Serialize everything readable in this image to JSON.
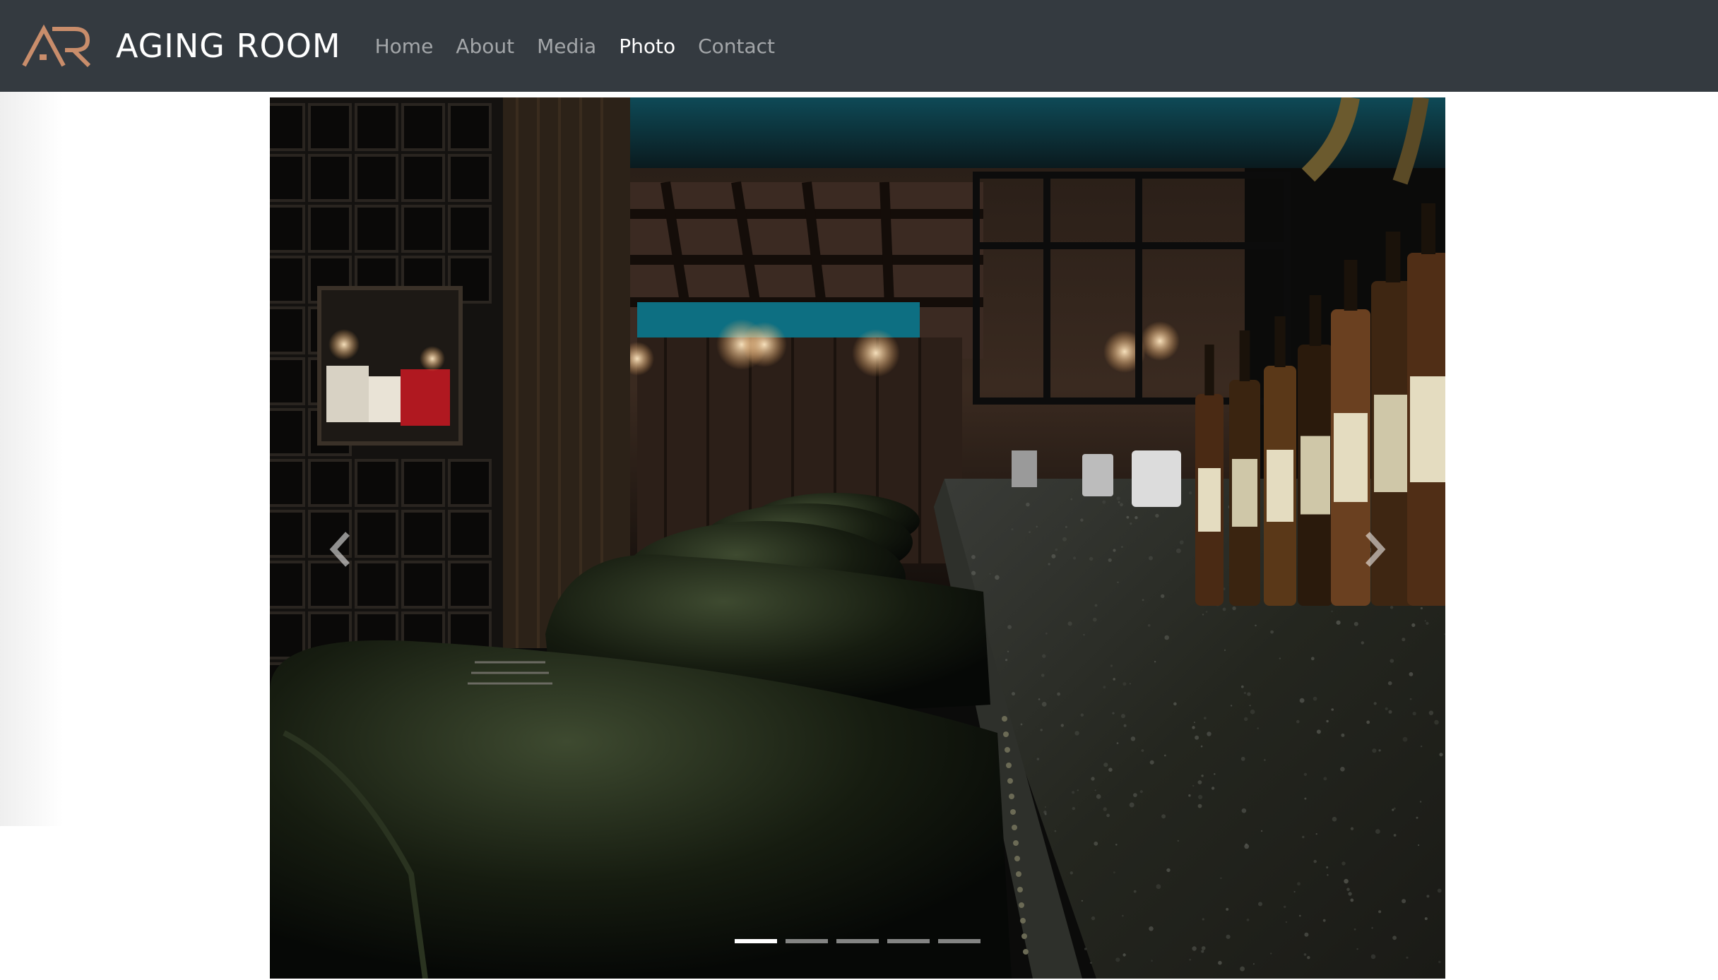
{
  "brand": {
    "name": "AGING ROOM",
    "logo_icon": "ar-monogram-logo",
    "logo_color": "#c98d6b"
  },
  "nav": {
    "items": [
      {
        "label": "Home",
        "active": false
      },
      {
        "label": "About",
        "active": false
      },
      {
        "label": "Media",
        "active": false
      },
      {
        "label": "Photo",
        "active": true
      },
      {
        "label": "Contact",
        "active": false
      }
    ]
  },
  "carousel": {
    "slide_count": 5,
    "active_index": 0,
    "prev_icon": "chevron-left-icon",
    "next_icon": "chevron-right-icon"
  },
  "colors": {
    "navbar_bg": "#343a40",
    "nav_active": "#ffffff",
    "nav_inactive": "rgba(255,255,255,0.55)"
  }
}
